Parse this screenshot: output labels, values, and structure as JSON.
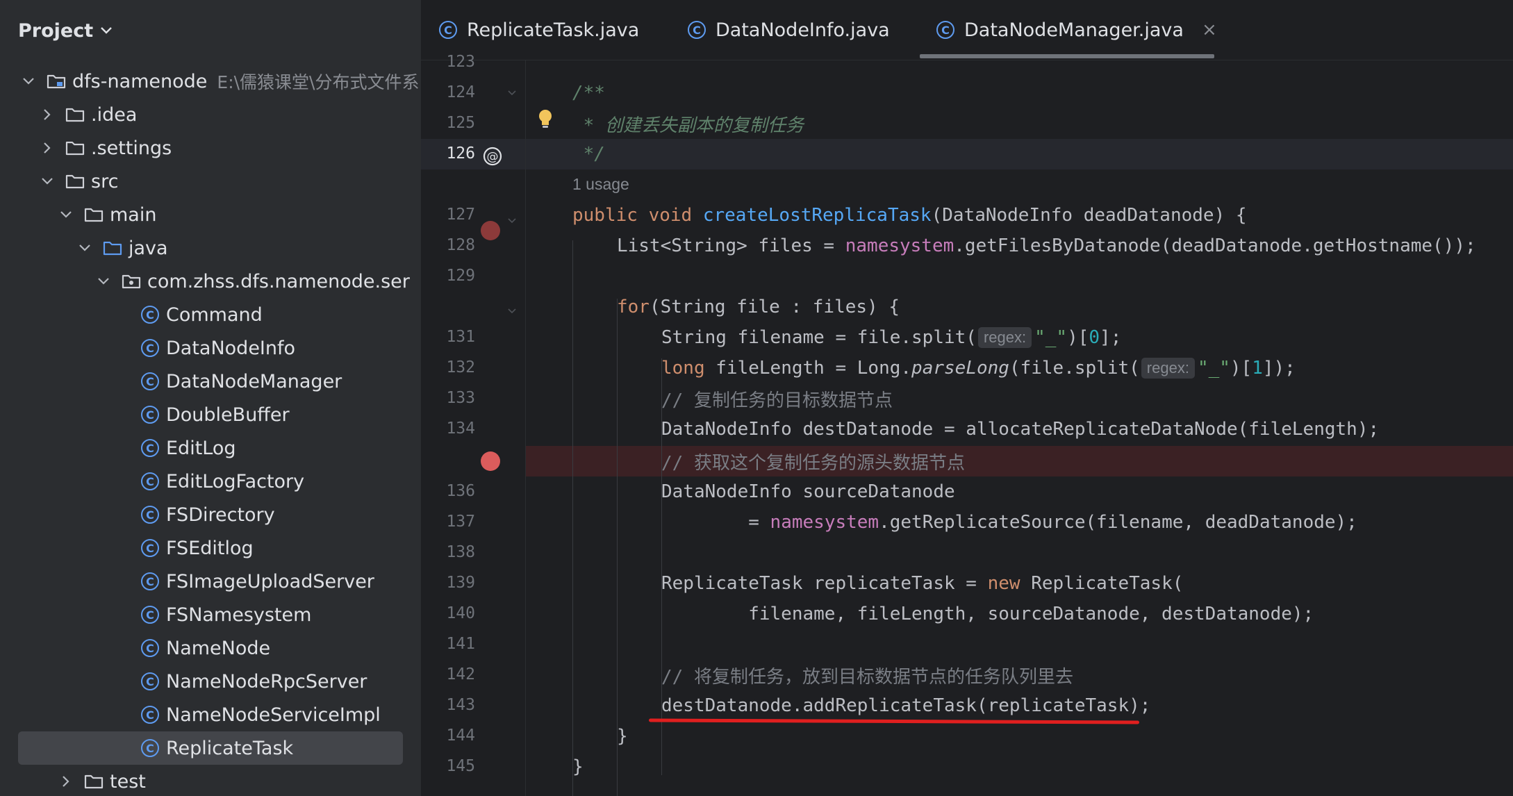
{
  "project_panel": {
    "title": "Project",
    "tree": [
      {
        "label": "dfs-namenode",
        "hint": "E:\\儒猿课堂\\分布式文件系",
        "type": "module",
        "expanded": true
      },
      {
        "label": ".idea",
        "type": "folder",
        "expanded": false
      },
      {
        "label": ".settings",
        "type": "folder",
        "expanded": false
      },
      {
        "label": "src",
        "type": "folder",
        "expanded": true
      },
      {
        "label": "main",
        "type": "folder",
        "expanded": true
      },
      {
        "label": "java",
        "type": "source-folder",
        "expanded": true
      },
      {
        "label": "com.zhss.dfs.namenode.ser",
        "type": "package",
        "expanded": true
      },
      {
        "label": "Command",
        "type": "class"
      },
      {
        "label": "DataNodeInfo",
        "type": "class"
      },
      {
        "label": "DataNodeManager",
        "type": "class"
      },
      {
        "label": "DoubleBuffer",
        "type": "class"
      },
      {
        "label": "EditLog",
        "type": "class"
      },
      {
        "label": "EditLogFactory",
        "type": "class"
      },
      {
        "label": "FSDirectory",
        "type": "class"
      },
      {
        "label": "FSEditlog",
        "type": "class"
      },
      {
        "label": "FSImageUploadServer",
        "type": "class"
      },
      {
        "label": "FSNamesystem",
        "type": "class"
      },
      {
        "label": "NameNode",
        "type": "class"
      },
      {
        "label": "NameNodeRpcServer",
        "type": "class"
      },
      {
        "label": "NameNodeServiceImpl",
        "type": "class"
      },
      {
        "label": "ReplicateTask",
        "type": "class",
        "selected": true
      },
      {
        "label": "test",
        "type": "folder",
        "expanded": false
      }
    ]
  },
  "tabs": [
    {
      "label": "ReplicateTask.java",
      "icon": "class-icon"
    },
    {
      "label": "DataNodeInfo.java",
      "icon": "class-icon"
    },
    {
      "label": "DataNodeManager.java",
      "icon": "class-icon",
      "active": true,
      "close": "×"
    }
  ],
  "editor": {
    "line_numbers": [
      "123",
      "124",
      "125",
      "126",
      "",
      "127",
      "128",
      "129",
      "",
      "131",
      "132",
      "133",
      "134",
      "",
      "136",
      "137",
      "138",
      "139",
      "140",
      "141",
      "142",
      "143",
      "144",
      "145"
    ],
    "current_line": "126",
    "usage_hint": "1 usage",
    "inlay_regex": "regex:",
    "doc": {
      "open": "/**",
      "comment": " * 创建丢失副本的复制任务",
      "close": " */"
    },
    "comments": {
      "c133": "// 复制任务的目标数据节点",
      "c135": "// 获取这个复制任务的源头数据节点",
      "c142": "// 将复制任务，放到目标数据节点的任务队列里去"
    },
    "code": {
      "l127_kw": "public void ",
      "l127_fn": "createLostReplicaTask",
      "l127_rest": "(DataNodeInfo deadDatanode) {",
      "l128_a": "List<String> files = ",
      "l128_fld": "namesystem",
      "l128_b": ".getFilesByDatanode(deadDatanode.getHostname());",
      "l130_kw": "for",
      "l130_rest": "(String file : files) {",
      "l131_a": "String filename = file.split(",
      "l131_str": "\"_\"",
      "l131_b": ")[",
      "l131_num": "0",
      "l131_c": "];",
      "l132_kw": "long ",
      "l132_a": "fileLength = Long.",
      "l132_it": "parseLong",
      "l132_b": "(file.split(",
      "l132_str": "\"_\"",
      "l132_c": ")[",
      "l132_num": "1",
      "l132_d": "]);",
      "l134": "DataNodeInfo destDatanode = allocateReplicateDataNode(fileLength);",
      "l136": "DataNodeInfo sourceDatanode",
      "l137_a": "        = ",
      "l137_fld": "namesystem",
      "l137_b": ".getReplicateSource(filename, deadDatanode);",
      "l139_a": "ReplicateTask replicateTask = ",
      "l139_kw": "new ",
      "l139_b": "ReplicateTask(",
      "l140": "        filename, fileLength, sourceDatanode, destDatanode);",
      "l143": "destDatanode.addReplicateTask(replicateTask);",
      "l144": "}",
      "l145": "}"
    }
  },
  "colors": {
    "keyword": "#cf8e6d",
    "function": "#56a8f5",
    "field": "#c77dbb",
    "string": "#6aab73",
    "number": "#2aacb8",
    "breakpoint": "#db5c5c",
    "annotation_underline": "#e01f1f"
  }
}
